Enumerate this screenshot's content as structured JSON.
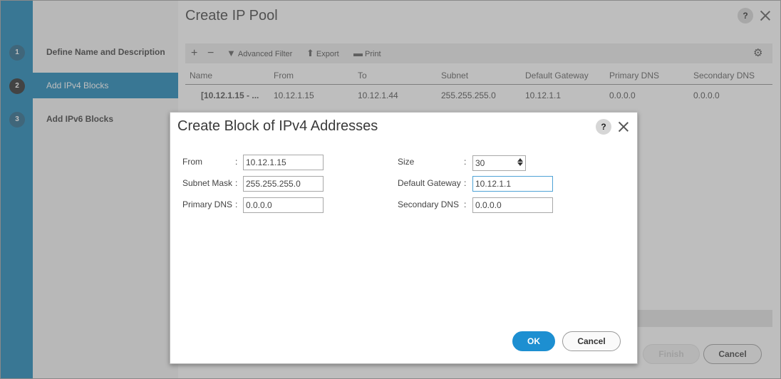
{
  "wizard": {
    "steps": [
      {
        "num": "1",
        "label": "Define Name and Description"
      },
      {
        "num": "2",
        "label": "Add IPv4 Blocks"
      },
      {
        "num": "3",
        "label": "Add IPv6 Blocks"
      }
    ]
  },
  "main": {
    "title": "Create IP Pool",
    "toolbar": {
      "add_icon": "+",
      "remove_icon": "−",
      "filter_label": "Advanced Filter",
      "export_label": "Export",
      "print_label": "Print"
    },
    "grid": {
      "columns": [
        "Name",
        "From",
        "To",
        "Subnet",
        "Default Gateway",
        "Primary DNS",
        "Secondary DNS"
      ],
      "rows": [
        [
          "[10.12.1.15 - ...",
          "10.12.1.15",
          "10.12.1.44",
          "255.255.255.0",
          "10.12.1.1",
          "0.0.0.0",
          "0.0.0.0"
        ]
      ]
    },
    "finish_label": "Finish",
    "cancel_label": "Cancel"
  },
  "dialog": {
    "title": "Create Block of IPv4 Addresses",
    "help": "?",
    "fields": {
      "from": {
        "label": "From",
        "value": "10.12.1.15"
      },
      "subnet_mask": {
        "label": "Subnet Mask",
        "value": "255.255.255.0"
      },
      "primary_dns": {
        "label": "Primary DNS",
        "value": "0.0.0.0"
      },
      "size": {
        "label": "Size",
        "value": "30"
      },
      "default_gateway": {
        "label": "Default Gateway",
        "value": "10.12.1.1"
      },
      "secondary_dns": {
        "label": "Secondary DNS",
        "value": "0.0.0.0"
      }
    },
    "ok_label": "OK",
    "cancel_label": "Cancel"
  },
  "help_glyph": "?",
  "colors": {
    "accent": "#0d7fb3",
    "ok_button": "#1d8fd1"
  }
}
